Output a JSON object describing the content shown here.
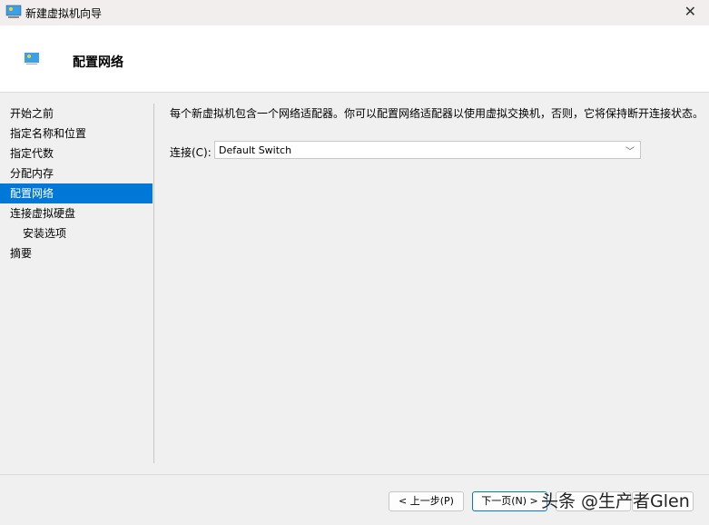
{
  "window": {
    "title": "新建虚拟机向导",
    "icon": "monitor-icon"
  },
  "header": {
    "title": "配置网络"
  },
  "nav": {
    "items": [
      {
        "label": "开始之前"
      },
      {
        "label": "指定名称和位置"
      },
      {
        "label": "指定代数"
      },
      {
        "label": "分配内存"
      },
      {
        "label": "配置网络",
        "selected": true
      },
      {
        "label": "连接虚拟硬盘"
      },
      {
        "label": "安装选项",
        "sub": true
      },
      {
        "label": "摘要"
      }
    ]
  },
  "main": {
    "description": "每个新虚拟机包含一个网络适配器。你可以配置网络适配器以使用虚拟交换机，否则，它将保持断开连接状态。",
    "connection_label": "连接(C):",
    "connection_value": "Default Switch"
  },
  "footer": {
    "prev": "< 上一步(P)",
    "next": "下一页(N) >",
    "finish": "完成(F)",
    "cancel": "取消"
  },
  "watermark": "头条 @生产者Glen",
  "colors": {
    "accent": "#0078d7"
  }
}
